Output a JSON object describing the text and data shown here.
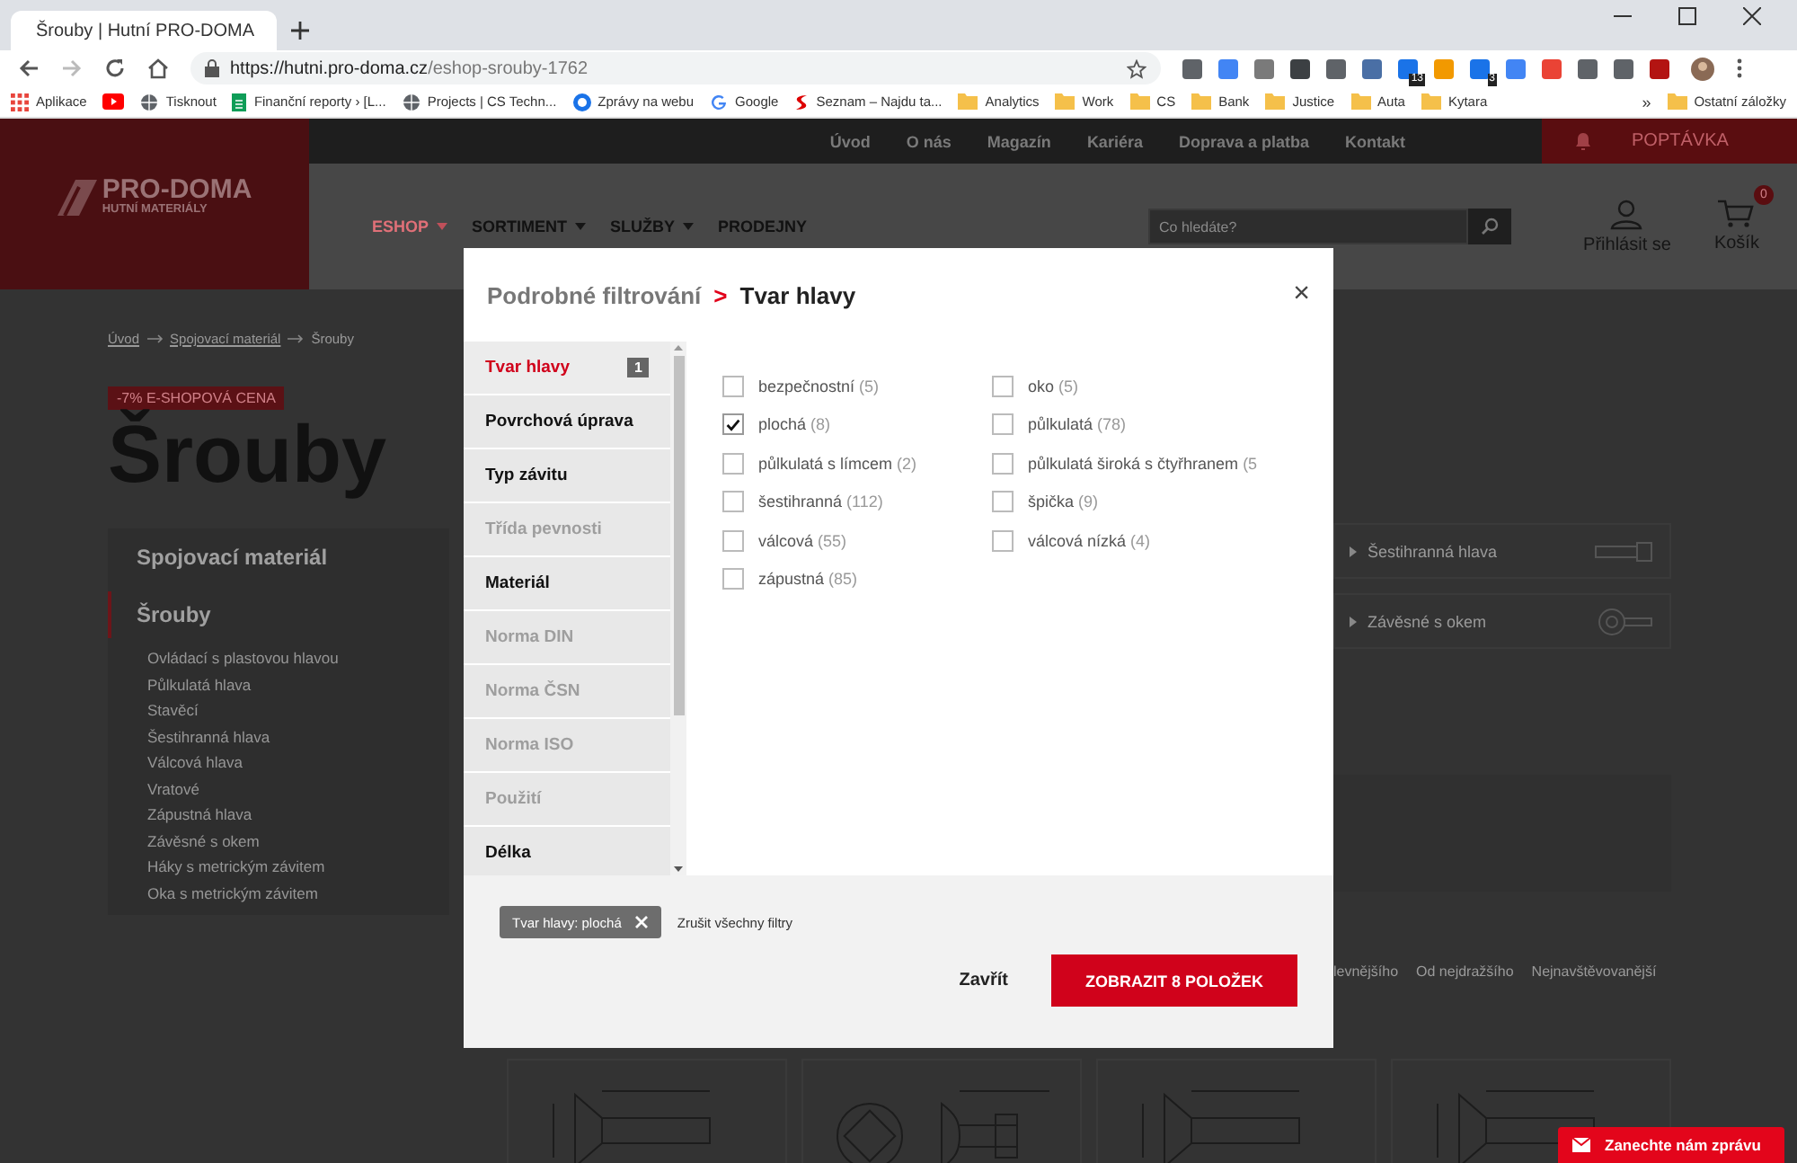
{
  "browser": {
    "tabs": [
      {
        "title": "Šrouby | Hutní PRO-DOMA",
        "selected": true
      }
    ],
    "url_host": "https://hutni.pro-doma.cz",
    "url_path": "/eshop-srouby-1762",
    "extensions": [
      {
        "color": "#5f6368"
      },
      {
        "color": "#4285f4"
      },
      {
        "color": "#7a7a7a"
      },
      {
        "color": "#3c4043"
      },
      {
        "color": "#5f6368"
      },
      {
        "color": "#4a6fa5"
      },
      {
        "color": "#1a73e8",
        "badge": "13"
      },
      {
        "color": "#f29900"
      },
      {
        "color": "#1a73e8",
        "badge": "3"
      },
      {
        "color": "#4285f4"
      },
      {
        "color": "#ea4335"
      },
      {
        "color": "#5f6368"
      },
      {
        "color": "#5f6368"
      },
      {
        "color": "#b31412"
      }
    ],
    "bookmarks": [
      {
        "kind": "apps",
        "label": "Aplikace"
      },
      {
        "kind": "youtube"
      },
      {
        "kind": "globe",
        "label": "Tisknout"
      },
      {
        "kind": "sheet",
        "label": "Finanční reporty › [L..."
      },
      {
        "kind": "globe",
        "label": "Projects | CS Techn..."
      },
      {
        "kind": "news",
        "label": "Zprávy na webu"
      },
      {
        "kind": "google",
        "label": "Google"
      },
      {
        "kind": "seznam",
        "label": "Seznam – Najdu ta..."
      },
      {
        "kind": "folder",
        "label": "Analytics"
      },
      {
        "kind": "folder",
        "label": "Work"
      },
      {
        "kind": "folder",
        "label": "CS"
      },
      {
        "kind": "folder",
        "label": "Bank"
      },
      {
        "kind": "folder",
        "label": "Justice"
      },
      {
        "kind": "folder",
        "label": "Auta"
      },
      {
        "kind": "folder",
        "label": "Kytara"
      }
    ],
    "more": "»",
    "other_bookmarks": "Ostatní záložky"
  },
  "site": {
    "top_nav": [
      "Úvod",
      "O nás",
      "Magazín",
      "Kariéra",
      "Doprava a platba",
      "Kontakt"
    ],
    "inquiry": "POPTÁVKA",
    "logo": {
      "name": "PRO-DOMA",
      "tagline": "HUTNÍ MATERIÁLY"
    },
    "menu": [
      {
        "label": "ESHOP",
        "selected": true,
        "dropdown": true
      },
      {
        "label": "SORTIMENT",
        "selected": false,
        "dropdown": true
      },
      {
        "label": "SLUŽBY",
        "selected": false,
        "dropdown": true
      },
      {
        "label": "PRODEJNY",
        "selected": false,
        "dropdown": false
      }
    ],
    "search_placeholder": "Co hledáte?",
    "login": "Přihlásit se",
    "cart": {
      "label": "Košík",
      "count": "0"
    }
  },
  "breadcrumb": [
    "Úvod",
    "Spojovací materiál",
    "Šrouby"
  ],
  "promo": "-7% E-SHOPOVÁ CENA",
  "heading": "Šrouby",
  "category_panel": {
    "parent": "Spojovací materiál",
    "current": "Šrouby",
    "items": [
      "Ovládací s plastovou hlavou",
      "Půlkulatá hlava",
      "Stavěcí",
      "Šestihranná hlava",
      "Válcová hlava",
      "Vratové",
      "Zápustná hlava",
      "Závěsné s okem",
      "Háky s metrickým závitem",
      "Oka s metrickým závitem"
    ]
  },
  "subcategories": [
    {
      "label": "Šestihranná hlava",
      "kind": "hex"
    },
    {
      "label": "Závěsné s okem",
      "kind": "eye"
    }
  ],
  "sort_options": [
    "levnějšího",
    "Od nejdražšího",
    "Nejnavštěvovanější"
  ],
  "products": [
    {
      "kind": "countersunk"
    },
    {
      "kind": "carriage"
    },
    {
      "kind": "countersunk"
    },
    {
      "kind": "countersunk"
    }
  ],
  "modal": {
    "title": "Podrobné filtrování",
    "separator": ">",
    "subtitle": "Tvar hlavy",
    "close": "×",
    "groups": [
      {
        "label": "Tvar hlavy",
        "selected": true,
        "disabled": false,
        "count": "1"
      },
      {
        "label": "Povrchová úprava",
        "selected": false,
        "disabled": false
      },
      {
        "label": "Typ závitu",
        "selected": false,
        "disabled": false
      },
      {
        "label": "Třída pevnosti",
        "selected": false,
        "disabled": true
      },
      {
        "label": "Materiál",
        "selected": false,
        "disabled": false
      },
      {
        "label": "Norma DIN",
        "selected": false,
        "disabled": true
      },
      {
        "label": "Norma ČSN",
        "selected": false,
        "disabled": true
      },
      {
        "label": "Norma ISO",
        "selected": false,
        "disabled": true
      },
      {
        "label": "Použití",
        "selected": false,
        "disabled": true
      },
      {
        "label": "Délka",
        "selected": false,
        "disabled": false
      }
    ],
    "options": [
      {
        "label": "bezpečnostní",
        "count": "(5)",
        "checked": false
      },
      {
        "label": "plochá",
        "count": "(8)",
        "checked": true
      },
      {
        "label": "půlkulatá s límcem",
        "count": "(2)",
        "checked": false
      },
      {
        "label": "šestihranná",
        "count": "(112)",
        "checked": false
      },
      {
        "label": "válcová",
        "count": "(55)",
        "checked": false
      },
      {
        "label": "zápustná",
        "count": "(85)",
        "checked": false
      },
      {
        "label": "oko",
        "count": "(5)",
        "checked": false
      },
      {
        "label": "půlkulatá",
        "count": "(78)",
        "checked": false
      },
      {
        "label": "půlkulatá široká s čtyřhranem",
        "count": "(5",
        "checked": false
      },
      {
        "label": "špička",
        "count": "(9)",
        "checked": false
      },
      {
        "label": "válcová nízká",
        "count": "(4)",
        "checked": false
      }
    ],
    "active_filters": [
      {
        "label": "Tvar hlavy: plochá"
      }
    ],
    "clear_all": "Zrušit všechny filtry",
    "close_button": "Zavřít",
    "submit": "ZOBRAZIT 8 POLOŽEK"
  },
  "chat": "Zanechte nám zprávu"
}
